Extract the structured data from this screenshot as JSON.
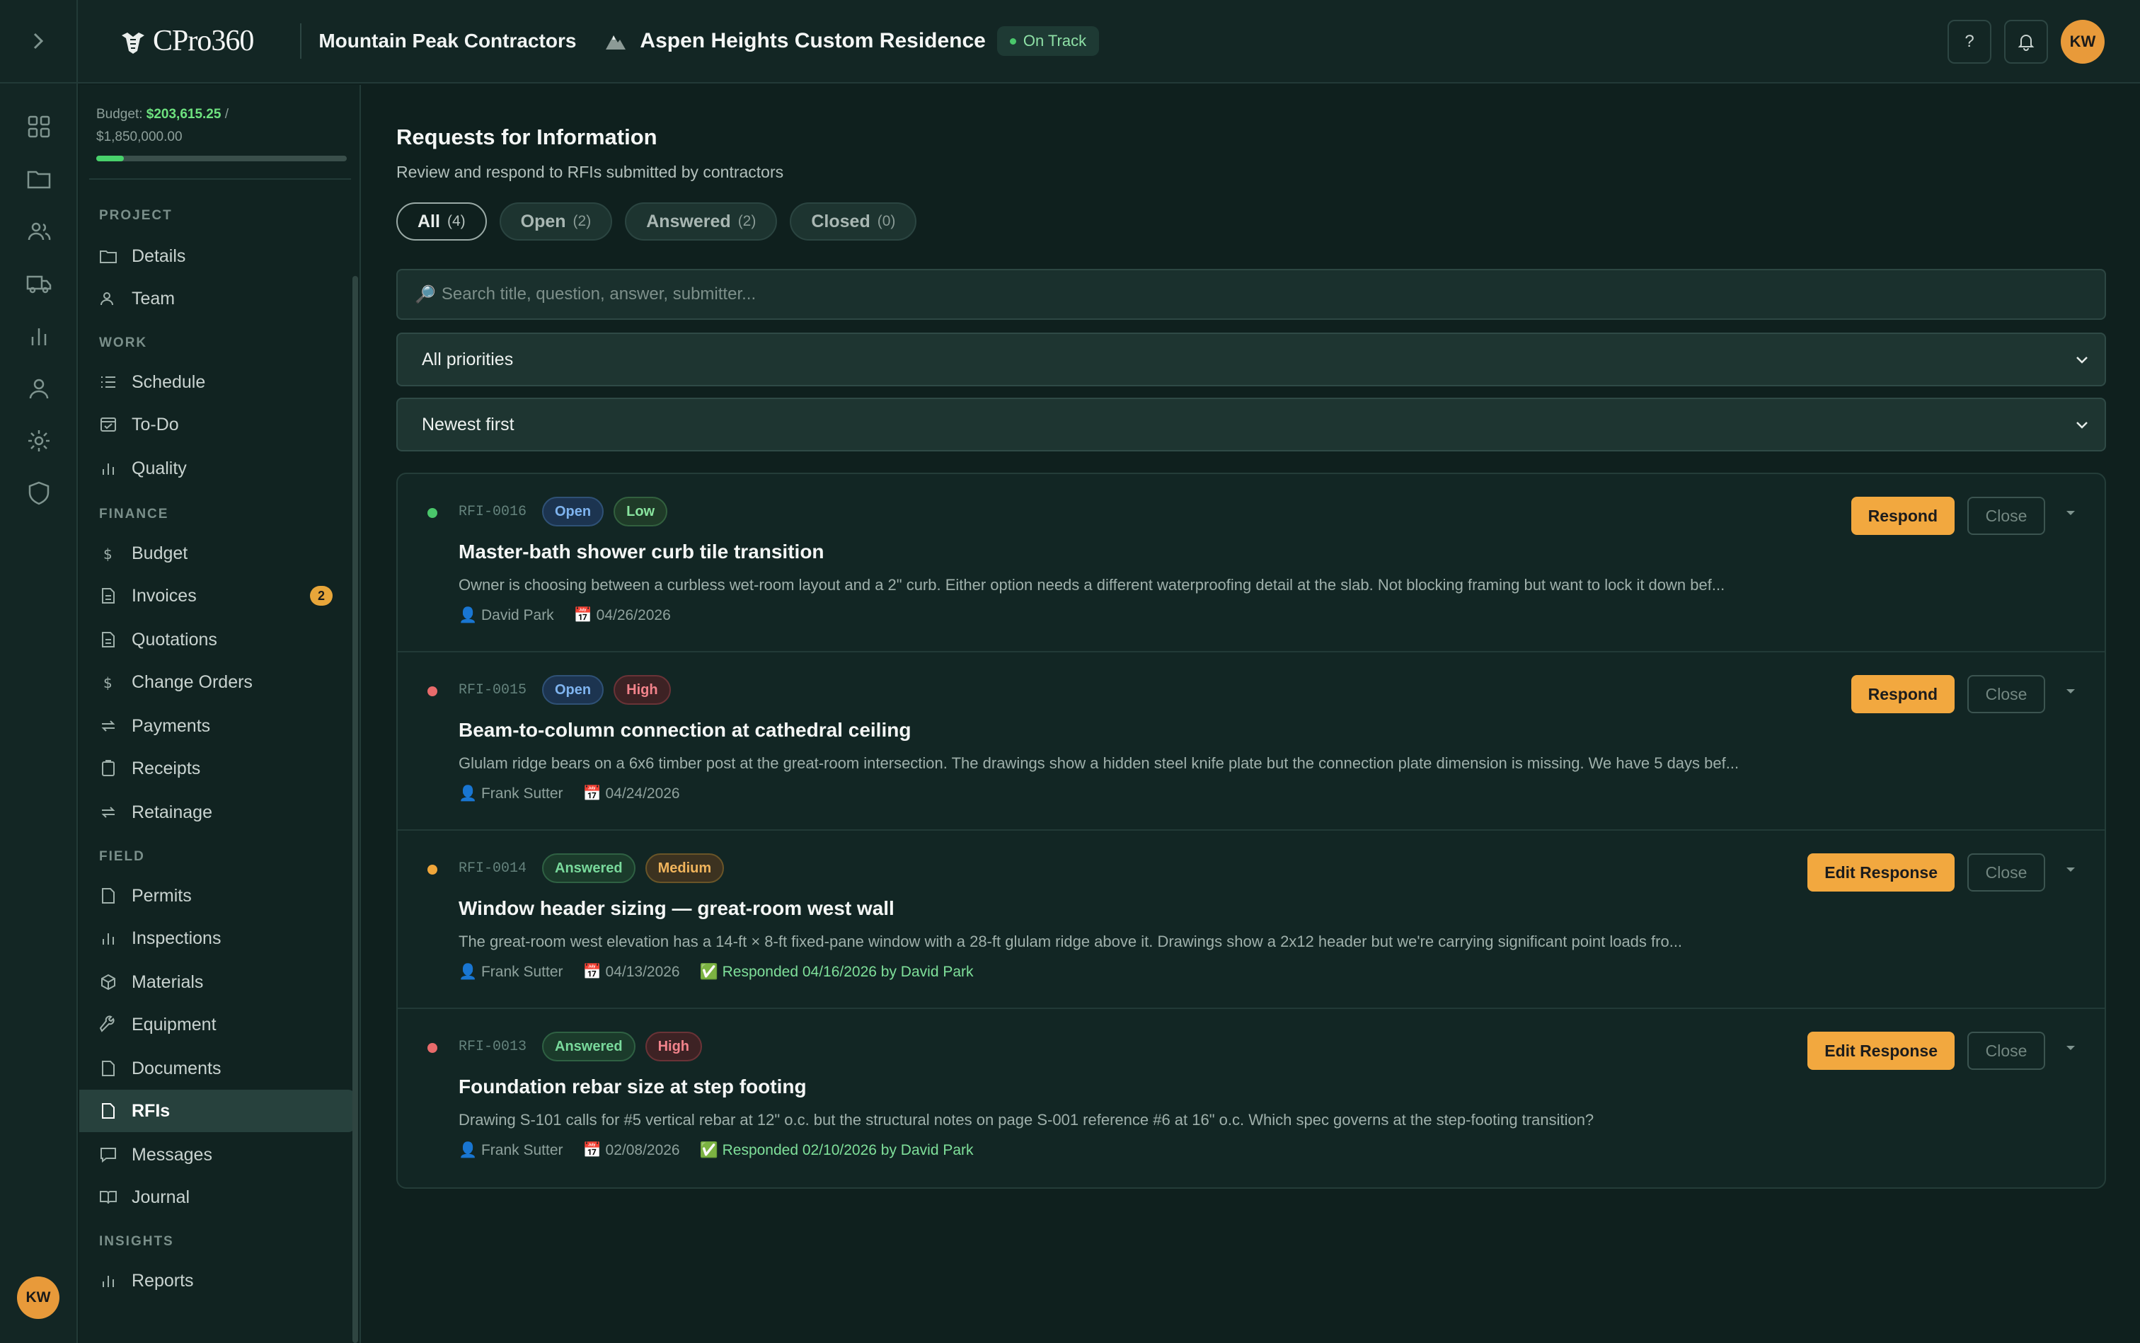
{
  "header": {
    "logo_text": "CPro360",
    "company": "Mountain Peak Contractors",
    "project": "Aspen Heights Custom Residence",
    "status": "On Track",
    "help_label": "?",
    "user_initials": "KW"
  },
  "sidebar": {
    "budget_label": "Budget:",
    "budget_spent": "$203,615.25",
    "budget_sep": "/",
    "budget_total": "$1,850,000.00",
    "budget_progress": 0.11,
    "sections": {
      "project": "PROJECT",
      "work": "WORK",
      "finance": "FINANCE",
      "field": "FIELD",
      "insights": "INSIGHTS"
    },
    "items": {
      "details": "Details",
      "team": "Team",
      "schedule": "Schedule",
      "todo": "To-Do",
      "quality": "Quality",
      "budget": "Budget",
      "invoices": "Invoices",
      "invoices_badge": "2",
      "quotations": "Quotations",
      "change_orders": "Change Orders",
      "payments": "Payments",
      "receipts": "Receipts",
      "retainage": "Retainage",
      "permits": "Permits",
      "inspections": "Inspections",
      "materials": "Materials",
      "equipment": "Equipment",
      "documents": "Documents",
      "rfis": "RFIs",
      "messages": "Messages",
      "journal": "Journal",
      "reports": "Reports"
    },
    "rail_user_initials": "KW"
  },
  "main": {
    "title": "Requests for Information",
    "subtitle": "Review and respond to RFIs submitted by contractors",
    "tabs": [
      {
        "label": "All",
        "count": "(4)"
      },
      {
        "label": "Open",
        "count": "(2)"
      },
      {
        "label": "Answered",
        "count": "(2)"
      },
      {
        "label": "Closed",
        "count": "(0)"
      }
    ],
    "search_placeholder": "Search title, question, answer, submitter...",
    "priority_filter": "All priorities",
    "sort": "Newest first",
    "rfis": [
      {
        "id": "RFI-0016",
        "status": "Open",
        "priority": "Low",
        "title": "Master-bath shower curb tile transition",
        "description": "Owner is choosing between a curbless wet-room layout and a 2\" curb. Either option needs a different waterproofing detail at the slab. Not blocking framing but want to lock it down bef...",
        "submitter": "👤 David Park",
        "date": "📅 04/26/2026",
        "responded": "",
        "action": "Respond",
        "close": "Close"
      },
      {
        "id": "RFI-0015",
        "status": "Open",
        "priority": "High",
        "title": "Beam-to-column connection at cathedral ceiling",
        "description": "Glulam ridge bears on a 6x6 timber post at the great-room intersection. The drawings show a hidden steel knife plate but the connection plate dimension is missing. We have 5 days bef...",
        "submitter": "👤 Frank Sutter",
        "date": "📅 04/24/2026",
        "responded": "",
        "action": "Respond",
        "close": "Close"
      },
      {
        "id": "RFI-0014",
        "status": "Answered",
        "priority": "Medium",
        "title": "Window header sizing — great-room west wall",
        "description": "The great-room west elevation has a 14-ft × 8-ft fixed-pane window with a 28-ft glulam ridge above it. Drawings show a 2x12 header but we're carrying significant point loads fro...",
        "submitter": "👤 Frank Sutter",
        "date": "📅 04/13/2026",
        "responded": "✅ Responded 04/16/2026 by David Park",
        "action": "Edit Response",
        "close": "Close"
      },
      {
        "id": "RFI-0013",
        "status": "Answered",
        "priority": "High",
        "title": "Foundation rebar size at step footing",
        "description": "Drawing S-101 calls for #5 vertical rebar at 12\" o.c. but the structural notes on page S-001 reference #6 at 16\" o.c. Which spec governs at the step-footing transition?",
        "submitter": "👤 Frank Sutter",
        "date": "📅 02/08/2026",
        "responded": "✅ Responded 02/10/2026 by David Park",
        "action": "Edit Response",
        "close": "Close"
      }
    ]
  },
  "colors": {
    "accent": "#f2a83f",
    "low": "#4ac76b",
    "high": "#e86b6b",
    "medium": "#f0a63a",
    "background": "#0f201e"
  }
}
